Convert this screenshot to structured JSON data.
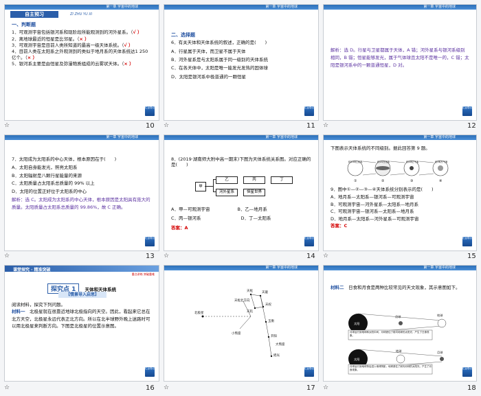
{
  "header_title": "第一章  宇宙中的地球",
  "nav_label": "栏目导引",
  "slide_numbers": [
    "10",
    "11",
    "12",
    "13",
    "14",
    "15",
    "16",
    "17",
    "18"
  ],
  "s10": {
    "banner": "自主预习",
    "banner_pinyin": "ZI ZHU YU XI",
    "section": "一、判断题",
    "items": [
      "1．可观测宇宙包括银河系和现阶段所能观测到的河外星系。（",
      "2．离地球最近的恒星是比邻星。（",
      "3．可观测宇宙是目前人类所知道的最高一级天体系统。（",
      "4．目前人类在太阳系之外观测到的类似于地月系的天体系统达1 250亿个。（",
      "5．银河系主要是由恒星及弥漫物质组成的云雾状天体。（"
    ],
    "answers": [
      "√ ）",
      "× ）",
      "√ ）",
      "× ）",
      "× ）"
    ]
  },
  "s11": {
    "section": "二、选择题",
    "question": "6．有关天体和天体系统的叙述，正确的是(　　)",
    "options": [
      "A．行星属于天体，而卫星不属于天体",
      "B．河外星系是与太阳系属于同一级别的天体系统",
      "C．在各天体中，太阳是唯一能发光发热的固体球",
      "D．太阳是银河系中极普通的一颗恒星"
    ]
  },
  "s12": {
    "analysis": "解析：选 D。行星与卫星都属于天体，A 错；河外星系与银河系级别相同，B 错；恒星能够发光，属于气体球且太阳不是唯一的，C 错；太阳是银河系中的一颗普通恒星，D 对。"
  },
  "s13": {
    "question": "7．太阳成为太阳系的中心天体，根本原因在于(　　)",
    "options": [
      "A．太阳自身能发光，照亮太阳系",
      "B．太阳辐射是八颗行星能量的来源",
      "C．太阳质量占太阳系总质量的 99% 以上",
      "D．太阳的位置正好位于太阳系的中心"
    ],
    "analysis": "解析：选 C。太阳成为太阳系的中心天体，根本原因是太阳具有庞大的质量。太阳质量占太阳系总质量的 99.86%，故 C 正确。"
  },
  "s14": {
    "question": "8．(2019·湖南师大附中高一期末)下图为天体系统关系图。对应正确的是(　　)",
    "boxes": [
      "甲",
      "乙",
      "丙",
      "丁",
      "河外星系",
      "恒星世界"
    ],
    "options": [
      "A．甲—可观测宇宙",
      "B．乙—地月系",
      "C．丙—银河系",
      "D．丁—太阳系"
    ],
    "answer": "答案：A"
  },
  "s15": {
    "intro": "下图表示天体系统的不同级别。据此回答第 9 题。",
    "diagram_labels": [
      "约200亿光年",
      "约10万光年",
      "约40亿千米",
      "约38万千米",
      "①",
      "②",
      "③",
      "④"
    ],
    "question": "9．图中①—②—③—④天体系统分别表示的是(　　)",
    "options": [
      "A．地月系—太阳系—银河系—可观测宇宙",
      "B．可观测宇宙—河外星系—太阳系—地月系",
      "C．可观测宇宙—银河系—太阳系—地月系",
      "D．地月系—太阳系—河外星系—可观测宇宙"
    ],
    "answer": "答案：C"
  },
  "s16": {
    "banner": "课堂探究 · 精准突破",
    "banner_right": "重点讲练   突破重难",
    "heading": "探究点 1",
    "heading_sub": "天体和天体系统",
    "sub_banner": "【情景导入启思】",
    "text": "阅读材料，探究下列问题。",
    "material_label": "材料一",
    "material": "北极星就在很靠近地球北极指向的天空。因此，看起来它总在北方天空，北极星永远代表正北方向。所以在北半球野外晚上迷路时可以用北极星来判断方向。下图是北极星的位置示意图。"
  },
  "s17": {
    "labels": [
      "北极星",
      "天枢",
      "天璇",
      "天权",
      "天玑",
      "玉衡",
      "开阳",
      "摇光",
      "天枢北方向",
      "小熊座",
      "大熊座"
    ]
  },
  "s18": {
    "material_label": "材料二",
    "material": "日食和月食是两种比较常见的天文现象，其示意图如下。",
    "labels": [
      "太阳",
      "地球",
      "月球",
      "太阳",
      "地球",
      "月球"
    ],
    "caption1": "月球运行到地球和太阳中间，月球遮住了射向地球的太阳光，产生了日食现象。",
    "caption2": "月球运行到地球背后进入地球阴影，地球遮住了射向月球的太阳光，产生了月食现象。"
  }
}
